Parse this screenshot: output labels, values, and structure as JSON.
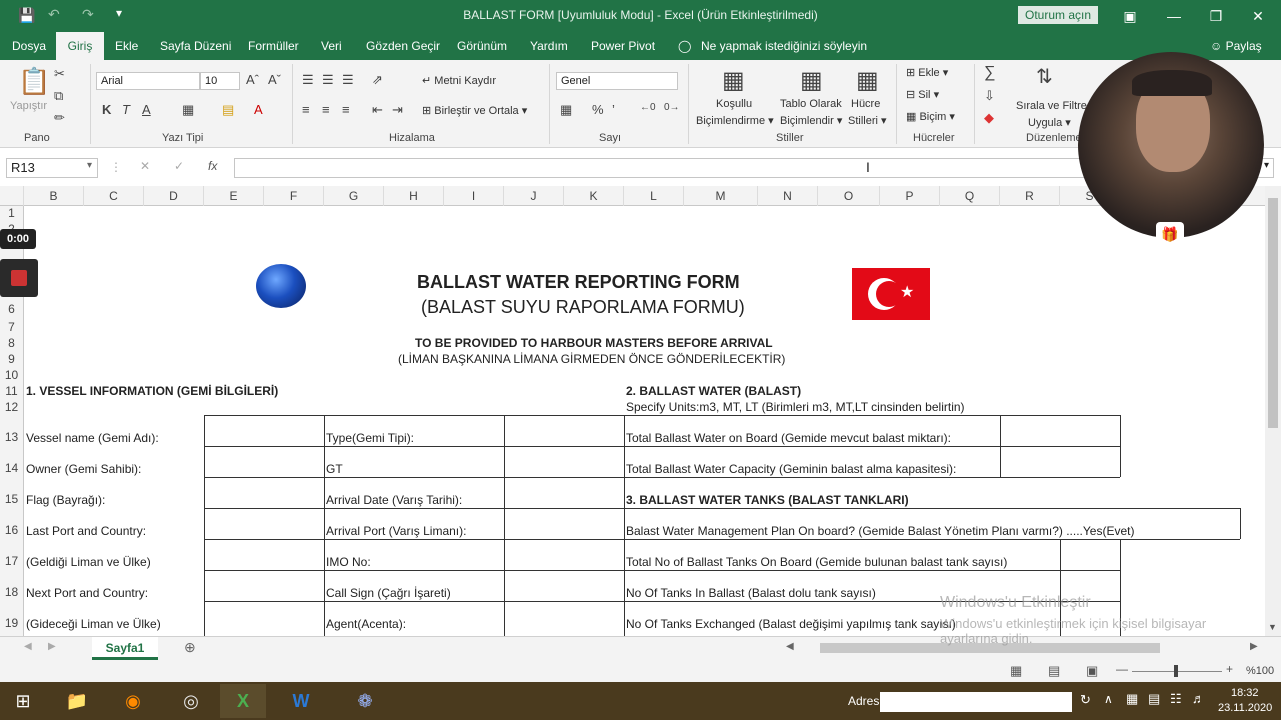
{
  "window": {
    "title": "BALLAST FORM  [Uyumluluk Modu]  -  Excel (Ürün Etkinleştirilmedi)",
    "signin": "Oturum açın"
  },
  "menu": [
    "Dosya",
    "Giriş",
    "Ekle",
    "Sayfa Düzeni",
    "Formüller",
    "Veri",
    "Gözden Geçir",
    "Görünüm",
    "Yardım",
    "Power Pivot"
  ],
  "tell_me": "Ne yapmak istediğinizi söyleyin",
  "share": "Paylaş",
  "ribbon": {
    "paste": "Yapıştır",
    "font_name": "Arial",
    "font_size": "10",
    "wrap": "Metni Kaydır",
    "merge": "Birleştir ve Ortala",
    "number_format": "Genel",
    "cond": "Koşullu",
    "cond2": "Biçimlendirme",
    "table": "Tablo Olarak",
    "table2": "Biçimlendir",
    "cellstyles": "Hücre",
    "cellstyles2": "Stilleri",
    "insert": "Ekle",
    "delete": "Sil",
    "format": "Biçim",
    "sort": "Sırala ve Filtre",
    "sort2": "Uygula",
    "groups": [
      "Pano",
      "Yazı Tipi",
      "Hizalama",
      "Sayı",
      "Stiller",
      "Hücreler",
      "Düzenleme"
    ]
  },
  "namebox": "R13",
  "columns": [
    "B",
    "C",
    "D",
    "E",
    "F",
    "G",
    "H",
    "I",
    "J",
    "K",
    "L",
    "M",
    "N",
    "O",
    "P",
    "Q",
    "R",
    "S"
  ],
  "rows": [
    "1",
    "2",
    "6",
    "7",
    "8",
    "9",
    "10",
    "11",
    "12",
    "13",
    "14",
    "15",
    "16",
    "17",
    "18",
    "19"
  ],
  "recording": {
    "time": "0:00"
  },
  "form": {
    "title": "BALLAST WATER REPORTING FORM",
    "title_tr": "(BALAST SUYU RAPORLAMA FORMU)",
    "sub": "TO BE PROVIDED TO HARBOUR MASTERS BEFORE ARRIVAL",
    "sub_tr": "(LİMAN BAŞKANINA LİMANA GİRMEDEN ÖNCE GÖNDERİLECEKTİR)",
    "sec1": "1. VESSEL INFORMATION (GEMİ BİLGİLERİ)",
    "sec2": "2. BALLAST WATER (BALAST)",
    "units": "Specify Units:m3, MT, LT (Birimleri m3, MT,LT cinsinden belirtin)",
    "left": [
      "Vessel name (Gemi Adı):",
      "Owner (Gemi Sahibi):",
      "Flag (Bayrağı):",
      "Last Port and Country:",
      "(Geldiği Liman ve Ülke)",
      "Next Port and Country:",
      "(Gideceği Liman ve Ülke)"
    ],
    "mid": [
      "Type(Gemi Tipi):",
      "GT",
      "Arrival Date (Varış Tarihi):",
      "Arrival Port (Varış Limanı):",
      "IMO No:",
      "Call Sign (Çağrı İşareti)",
      "Agent(Acenta):"
    ],
    "right": [
      "Total Ballast Water on Board (Gemide mevcut balast miktarı):",
      "Total Ballast Water Capacity (Geminin balast alma kapasitesi):",
      "3. BALLAST WATER TANKS (BALAST TANKLARI)",
      "Balast Water Management Plan On board? (Gemide Balast Yönetim Planı varmı?) .....Yes(Evet)",
      "Total No of Ballast Tanks On Board (Gemide bulunan balast tank sayısı)",
      "No Of Tanks In Ballast (Balast dolu tank sayısı)",
      "No Of Tanks Exchanged (Balast değişimi yapılmış tank sayısı)"
    ]
  },
  "sheet_tab": "Sayfa1",
  "activate": {
    "line1": "Windows'u Etkinleştir",
    "line2": "Windows'u etkinleştirmek için kişisel bilgisayar",
    "line3": "ayarlarına gidin."
  },
  "zoom": "%100",
  "taskbar": {
    "address_label": "Adres",
    "time": "18:32",
    "date": "23.11.2020"
  }
}
